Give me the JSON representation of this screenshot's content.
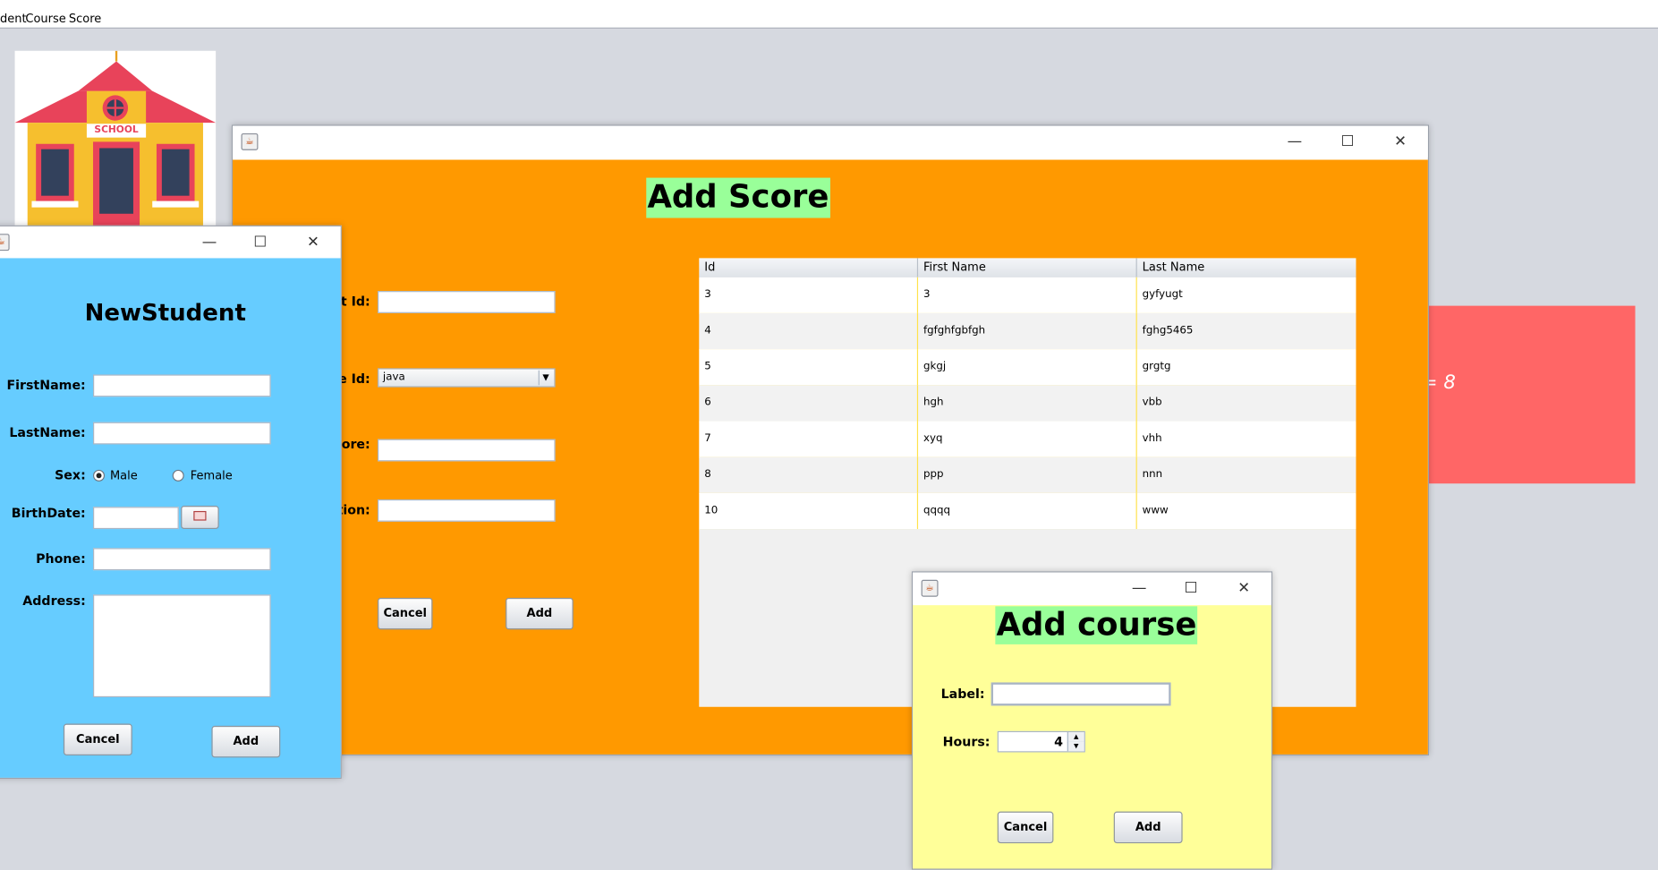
{
  "menubar": {
    "items": [
      "dent",
      "Course",
      "Score"
    ]
  },
  "background_panel": {
    "text": "= 8",
    "color": "#ff6666"
  },
  "logo": {
    "sign_text": "SCHOOL"
  },
  "score_window": {
    "title": "Add Score",
    "labels": {
      "student_id": "nt Id:",
      "course_id": "e Id:",
      "score": "core:",
      "option": "otion:"
    },
    "course_select_value": "java",
    "cancel_label": "Cancel",
    "add_label": "Add",
    "bg_color": "#ff9900",
    "table": {
      "columns": [
        "Id",
        "First Name",
        "Last Name"
      ],
      "rows": [
        [
          "3",
          "3",
          "gyfyugt"
        ],
        [
          "4",
          "fgfghfgbfgh",
          "fghg5465"
        ],
        [
          "5",
          "gkgj",
          "grgtg"
        ],
        [
          "6",
          "hgh",
          "vbb"
        ],
        [
          "7",
          "xyq",
          "vhh"
        ],
        [
          "8",
          "ppp",
          "nnn"
        ],
        [
          "10",
          "qqqq",
          "www"
        ]
      ]
    }
  },
  "student_window": {
    "title": "NewStudent",
    "labels": {
      "first_name": "FirstName:",
      "last_name": "LastName:",
      "sex": "Sex:",
      "birth_date": "BirthDate:",
      "phone": "Phone:",
      "address": "Address:"
    },
    "sex_options": [
      "Male",
      "Female"
    ],
    "sex_selected": "Male",
    "cancel_label": "Cancel",
    "add_label": "Add",
    "bg_color": "#66ccff"
  },
  "course_window": {
    "title": "Add course",
    "labels": {
      "label": "Label:",
      "hours": "Hours:"
    },
    "hours_value": "4",
    "cancel_label": "Cancel",
    "add_label": "Add",
    "bg_color": "#ffff99"
  },
  "heading_highlight_color": "#99ff99"
}
